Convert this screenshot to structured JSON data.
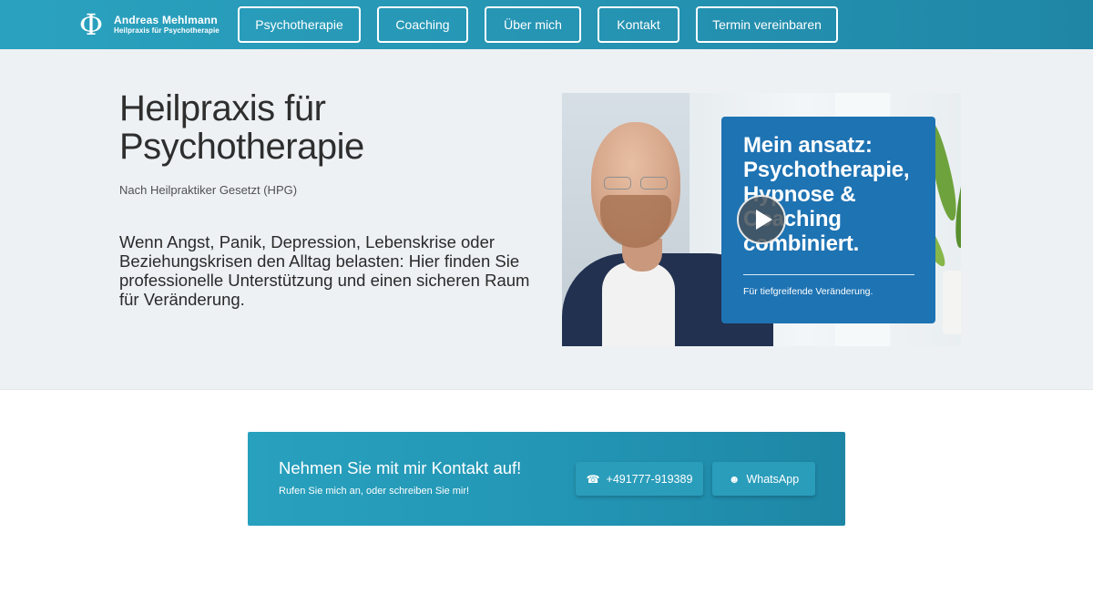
{
  "header": {
    "brand_glyph": "Φ",
    "brand_name": "Andreas Mehlmann",
    "brand_sub": "Heilpraxis für Psychotherapie",
    "nav": [
      {
        "label": "Psychotherapie"
      },
      {
        "label": "Coaching"
      },
      {
        "label": "Über mich"
      },
      {
        "label": "Kontakt"
      },
      {
        "label": "Termin vereinbaren"
      }
    ]
  },
  "hero": {
    "title": "Heilpraxis für Psychotherapie",
    "subtitle": "Nach Heilpraktiker Gesetzt (HPG)",
    "text": "Wenn Angst, Panik, Depression, Lebenskrise oder Beziehungskrisen den Alltag belasten: Hier finden Sie professionelle Unterstützung und einen sicheren Raum für Veränderung."
  },
  "video": {
    "card_title": "Mein ansatz: Psychotherapie, Hypnose & Coaching combiniert.",
    "card_subtitle": "Für tiefgreifende Veränderung.",
    "play_icon": "play-icon"
  },
  "contact": {
    "title": "Nehmen Sie mit mir Kontakt auf!",
    "subtitle": "Rufen Sie mich an, oder schreiben Sie mir!",
    "phone_icon": "☎",
    "phone_label": "+491777-919389",
    "whatsapp_icon": "☻",
    "whatsapp_label": "WhatsApp"
  },
  "colors": {
    "brand_teal": "#2595b4",
    "hero_bg": "#edf1f4",
    "card_blue": "#1e73b3"
  }
}
